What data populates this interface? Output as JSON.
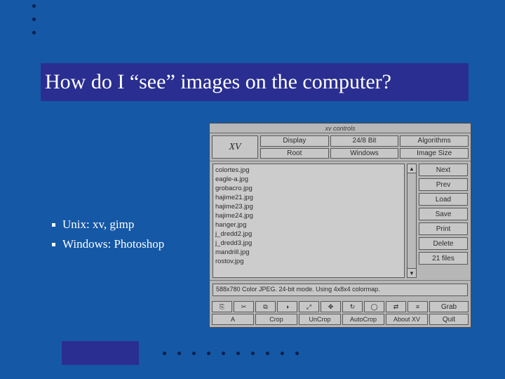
{
  "slide": {
    "title": "How do I “see” images on the computer?",
    "bullets": [
      "Unix: xv, gimp",
      "Windows: Photoshop"
    ]
  },
  "xv": {
    "window_title": "xv controls",
    "logo": "XV",
    "top_buttons": [
      "Display",
      "24/8 Bit",
      "Algorithms",
      "Root",
      "Windows",
      "Image Size"
    ],
    "files": [
      "colortes.jpg",
      "eagle-a.jpg",
      "grobacro.jpg",
      "hajime21.jpg",
      "hajime23.jpg",
      "hajime24.jpg",
      "hanger.jpg",
      "j_dredd2.jpg",
      "j_dredd3.jpg",
      "mandrill.jpg",
      "rostov.jpg"
    ],
    "side_buttons": [
      "Next",
      "Prev",
      "Load",
      "Save",
      "Print",
      "Delete",
      "21 files"
    ],
    "status": "588x780 Color JPEG.  24-bit mode.  Using 4x8x4 colormap.",
    "icon_glyphs": [
      "⎘",
      "✂",
      "⧉",
      "◑",
      "⤢",
      "✥",
      "↻",
      "◯",
      "⇄",
      "≡"
    ],
    "bottom_label_buttons": [
      "A",
      "Crop",
      "UnCrop",
      "AutoCrop",
      "About XV"
    ],
    "grab": "Grab",
    "quit": "Quit"
  }
}
